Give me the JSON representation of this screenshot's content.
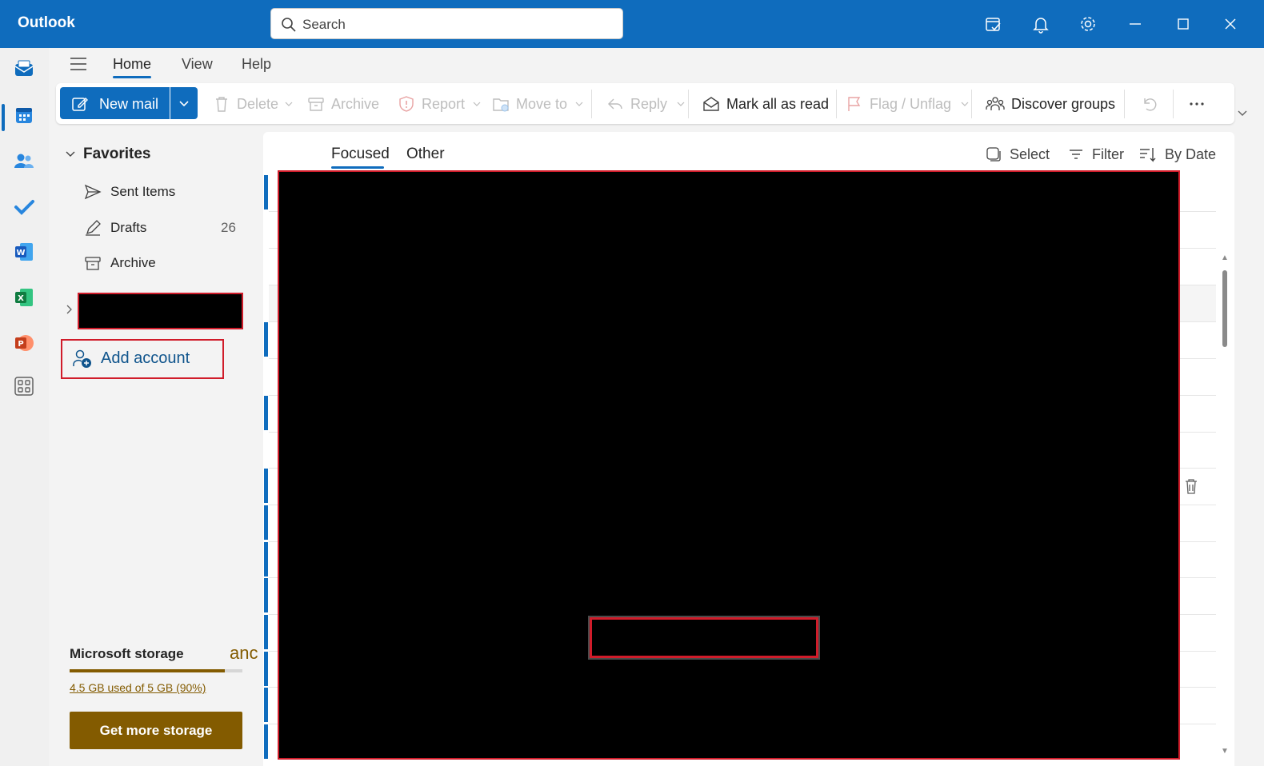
{
  "app": {
    "title": "Outlook"
  },
  "search": {
    "placeholder": "Search"
  },
  "menu": {
    "tabs": [
      "Home",
      "View",
      "Help"
    ],
    "active": "Home"
  },
  "ribbon": {
    "new_mail": "New mail",
    "delete": "Delete",
    "archive": "Archive",
    "report": "Report",
    "move_to": "Move to",
    "reply": "Reply",
    "mark_all_read": "Mark all as read",
    "flag": "Flag / Unflag",
    "discover_groups": "Discover groups"
  },
  "favorites": {
    "title": "Favorites",
    "items": [
      {
        "label": "Sent Items",
        "icon": "send-icon",
        "count": ""
      },
      {
        "label": "Drafts",
        "icon": "pencil-icon",
        "count": "26"
      },
      {
        "label": "Archive",
        "icon": "archive-icon",
        "count": ""
      }
    ]
  },
  "add_account": {
    "label": "Add account"
  },
  "storage": {
    "title": "Microsoft storage",
    "overflow_text": "anc",
    "used_text": "4.5 GB used of 5 GB (90%)",
    "used_fraction": 0.9,
    "button": "Get more storage"
  },
  "message_list": {
    "tabs": [
      "Focused",
      "Other"
    ],
    "active_tab": "Focused",
    "select": "Select",
    "filter": "Filter",
    "sort": "By Date"
  },
  "colors": {
    "brand": "#0f6cbd",
    "storage": "#835b00",
    "redaction_border": "#d01c2a"
  }
}
